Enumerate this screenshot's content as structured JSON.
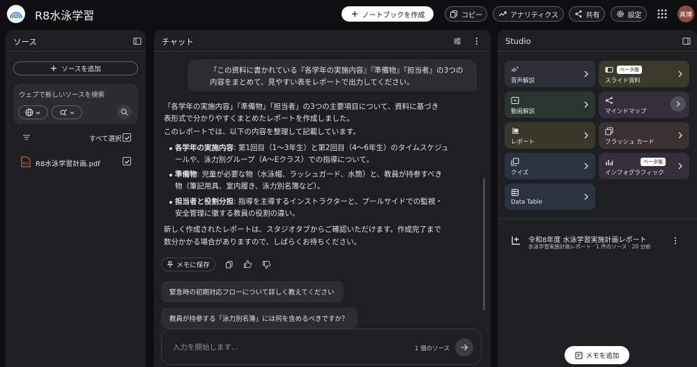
{
  "app": {
    "title": "R8水泳学習",
    "avatar_text": "真博"
  },
  "header": {
    "create_notebook": "ノートブックを作成",
    "copy": "コピー",
    "analytics": "アナリティクス",
    "share": "共有",
    "settings": "設定"
  },
  "sources": {
    "title": "ソース",
    "add_label": "ソースを追加",
    "search_placeholder": "ウェブで新しいソースを検索",
    "select_all": "すべて選択",
    "items": [
      {
        "name": "R8水泳学習計画.pdf",
        "checked": true
      }
    ]
  },
  "chat": {
    "title": "チャット",
    "user_message": "「この資料に書かれている『各学年の実施内容』『準備物』『担当者』の3つの内容をまとめて、見やすい表をレポートで出力してください。",
    "intro_lines": [
      "「各学年の実施内容」「準備物」「担当者」の3つの主要項目について、資料に基づき",
      "表形式で分かりやすくまとめたレポートを作成しました。",
      "このレポートでは、以下の内容を整理して記載しています。"
    ],
    "bullets": [
      {
        "bold": "各学年の実施内容",
        "line1": ": 第1回目（1〜3年生）と第2回目（4〜6年生）のタイムスケジュ",
        "line2": "ールや、泳力別グループ（A〜Eクラス）での指導について。"
      },
      {
        "bold": "準備物",
        "line1": ": 児童が必要な物（水泳帽、ラッシュガード、水筒）と、教員が持参すべき",
        "line2": "物（筆記用具、室内履き、泳力別名簿など）。"
      },
      {
        "bold": "担当者と役割分担",
        "line1": ": 指導を主導するインストラクターと、プールサイドでの監視・",
        "line2": "安全管理に徹する教員の役割の違い。"
      }
    ],
    "closing_lines": [
      "新しく作成されたレポートは、スタジオタブからご確認いただけます。作成完了まで",
      "数分かかる場合がありますので、しばらくお待ちください。"
    ],
    "save_memo": "メモに保存",
    "suggestions": [
      "緊急時の初期対応フローについて詳しく教えてください",
      "教員が持参する「泳力別名簿」には何を含めるべきですか？"
    ],
    "input_placeholder": "入力を開始します...",
    "source_count": "1 個のソース"
  },
  "studio": {
    "title": "Studio",
    "beta_label": "ベータ版",
    "tiles": [
      {
        "label": "音声解説",
        "icon": "audio-spark-icon",
        "color": "#2d3038"
      },
      {
        "label": "スライド資料",
        "icon": "slides-icon",
        "color": "#3a3a2b",
        "beta": true
      },
      {
        "label": "動画解説",
        "icon": "video-icon",
        "color": "#2b3530"
      },
      {
        "label": "マインドマップ",
        "icon": "mindmap-icon",
        "color": "#352f3b",
        "circle": true
      },
      {
        "label": "レポート",
        "icon": "report-icon",
        "color": "#37382a"
      },
      {
        "label": "フラッシュ カード",
        "icon": "flashcard-icon",
        "color": "#3a3230"
      },
      {
        "label": "クイズ",
        "icon": "quiz-icon",
        "color": "#2c3340"
      },
      {
        "label": "インフォグラフィック",
        "icon": "infographic-icon",
        "color": "#352f3b",
        "beta": true
      },
      {
        "label": "Data Table",
        "icon": "table-icon",
        "color": "#2c3340"
      }
    ],
    "report": {
      "title": "令和8年度 水泳学習実施計画レポート",
      "subtitle": "水泳学習実施計画レポート · 1 件のソース · 20 分前"
    },
    "add_memo": "メモを追加"
  }
}
